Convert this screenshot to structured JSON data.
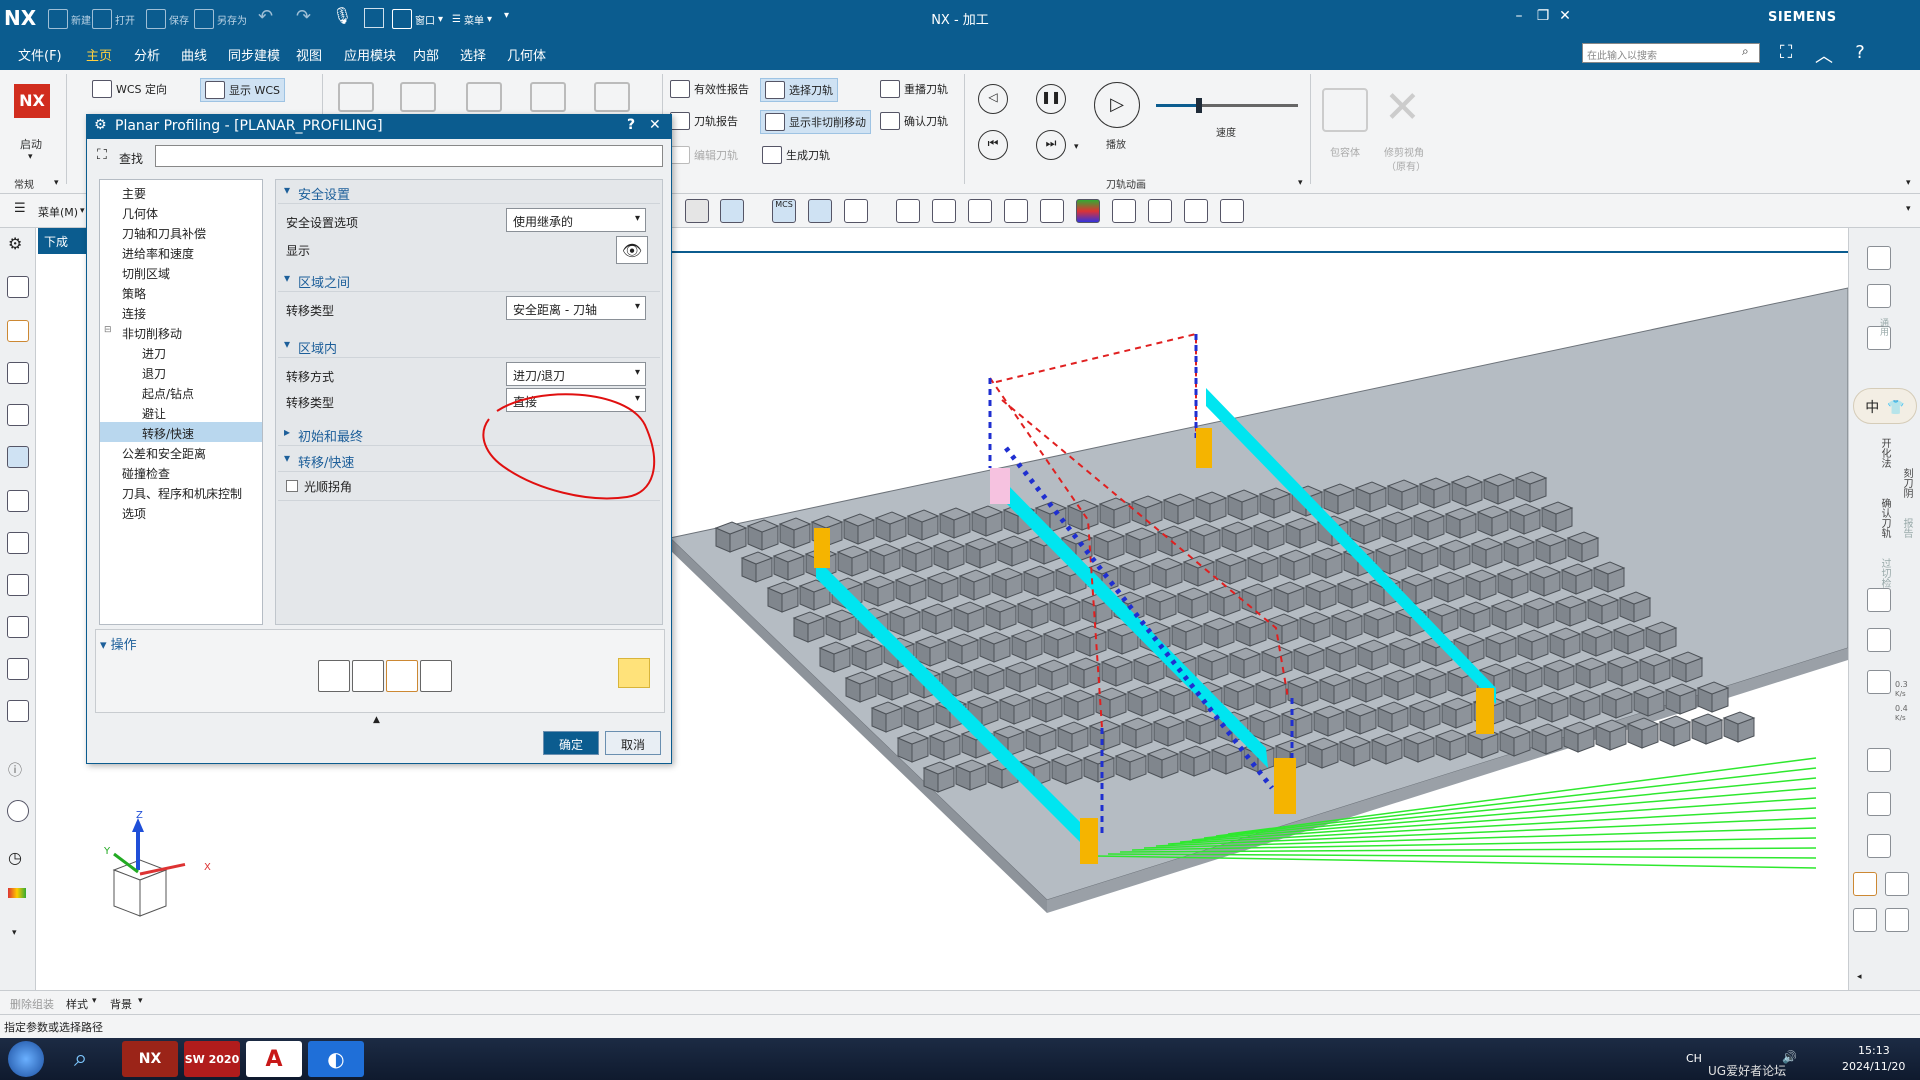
{
  "titlebar": {
    "logo": "NX",
    "quick_access": [
      "新建",
      "打开",
      "保存",
      "另存为"
    ],
    "window_menu": "窗口",
    "menu_label": "菜单",
    "app_title": "NX - 加工",
    "brand": "SIEMENS"
  },
  "menubar": {
    "file": "文件(F)",
    "tabs": [
      "主页",
      "分析",
      "曲线",
      "同步建模",
      "视图",
      "应用模块",
      "内部",
      "选择",
      "几何体"
    ],
    "active_tab": "主页",
    "search_placeholder": "在此输入以搜索"
  },
  "ribbon": {
    "start_label": "启动",
    "wcs_orient": "WCS 定向",
    "show_wcs": "显示 WCS",
    "common_label": "常规",
    "op_buttons": [
      "有效性报告",
      "选择刀轨",
      "重播刀轨",
      "刀轨报告",
      "显示非切削移动",
      "确认刀轨",
      "编辑刀轨",
      "生成刀轨"
    ],
    "play_label": "播放",
    "speed_label": "速度",
    "group_label": "刀轨动画",
    "wrap_label": "包容体",
    "trim_label": "修剪视角",
    "trim_sub": "（原有）",
    "speed_value": 0.3
  },
  "toolbar2": {
    "menu_label": "菜单(M)",
    "mcs_label": "MCS"
  },
  "nav_tab": "下成",
  "dialog": {
    "title": "Planar Profiling - [PLANAR_PROFILING]",
    "help": "?",
    "close": "✕",
    "find_label": "查找",
    "tree": [
      {
        "label": "主要",
        "level": 0
      },
      {
        "label": "几何体",
        "level": 0
      },
      {
        "label": "刀轴和刀具补偿",
        "level": 0
      },
      {
        "label": "进给率和速度",
        "level": 0
      },
      {
        "label": "切削区域",
        "level": 0
      },
      {
        "label": "策略",
        "level": 0
      },
      {
        "label": "连接",
        "level": 0
      },
      {
        "label": "非切削移动",
        "level": 0
      },
      {
        "label": "进刀",
        "level": 1
      },
      {
        "label": "退刀",
        "level": 1
      },
      {
        "label": "起点/钻点",
        "level": 1
      },
      {
        "label": "避让",
        "level": 1
      },
      {
        "label": "转移/快速",
        "level": 1,
        "selected": true
      },
      {
        "label": "公差和安全距离",
        "level": 0
      },
      {
        "label": "碰撞检查",
        "level": 0
      },
      {
        "label": "刀具、程序和机床控制",
        "level": 0
      },
      {
        "label": "选项",
        "level": 0
      }
    ],
    "sections": {
      "safety": "安全设置",
      "safety_option_label": "安全设置选项",
      "safety_option_value": "使用继承的",
      "display_label": "显示",
      "between": "区域之间",
      "between_type_label": "转移类型",
      "between_type_value": "安全距离 - 刀轴",
      "within": "区域内",
      "within_method_label": "转移方式",
      "within_method_value": "进刀/退刀",
      "within_type_label": "转移类型",
      "within_type_value": "直接",
      "initial_final": "初始和最终",
      "transfer_rapid": "转移/快速",
      "smooth_corner": "光顺拐角"
    },
    "ops_label": "操作",
    "ok": "确定",
    "cancel": "取消"
  },
  "axes": {
    "z": "Z",
    "y": "Y",
    "x": "X"
  },
  "rightbar": {
    "ime_char": "中",
    "labels": [
      "通用",
      "开化法",
      "刻刀阴",
      "确认刀轨",
      "过切检查",
      "报告"
    ],
    "speeds": [
      "0.3",
      "K/s",
      "0.4",
      "K/s"
    ]
  },
  "bottombar": {
    "items": [
      "删除组装",
      "样式",
      "背景"
    ]
  },
  "status_text": "指定参数或选择路径",
  "taskbar": {
    "apps": [
      "NX",
      "SW 2020",
      "A"
    ],
    "lang": "CH",
    "watermark": "UG爱好者论坛",
    "time": "15:13",
    "date": "2024/11/20"
  }
}
